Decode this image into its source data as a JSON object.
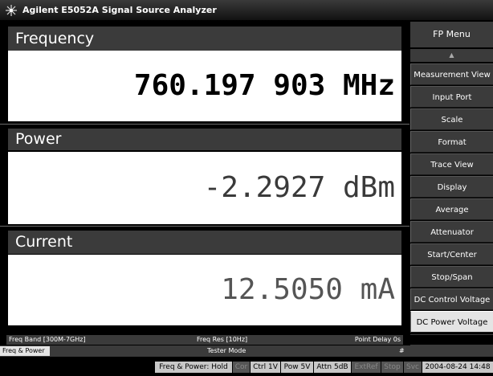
{
  "window": {
    "title": "Agilent E5052A Signal Source Analyzer",
    "icon": "agilent-spark-icon"
  },
  "panels": [
    {
      "label": "Frequency",
      "value": "760.197 903 MHz"
    },
    {
      "label": "Power",
      "value": "-2.2927 dBm"
    },
    {
      "label": "Current",
      "value": "12.5050 mA"
    }
  ],
  "menu": {
    "title": "FP Menu",
    "up_arrow": "▲",
    "down_arrow": "▼",
    "items": [
      "Measurement View",
      "Input Port",
      "Scale",
      "Format",
      "Trace View",
      "Display",
      "Average",
      "Attenuator",
      "Start/Center",
      "Stop/Span",
      "DC Control Voltage",
      "DC Power Voltage"
    ],
    "selected": "DC Power Voltage"
  },
  "status_bar_1": {
    "freq_band": "Freq Band [300M-7GHz]",
    "freq_res": "Freq Res [10Hz]",
    "point_delay": "Point Delay 0s"
  },
  "status_bar_2": {
    "mode": "Freq & Power",
    "tester": "Tester Mode",
    "hash": "#"
  },
  "status_bar_3": {
    "hold": "Freq & Power: Hold",
    "cor": "Cor",
    "ctrl": "Ctrl  1V",
    "pow": "Pow  5V",
    "attn": "Attn 5dB",
    "extref": "ExtRef",
    "stop": "Stop",
    "svc": "Svc",
    "datetime": "2004-08-24 14:48"
  },
  "colors": {
    "header_gray": "#3b3b3b",
    "value_bg": "#ffffff",
    "selected_menu": "#e4e4e4"
  }
}
